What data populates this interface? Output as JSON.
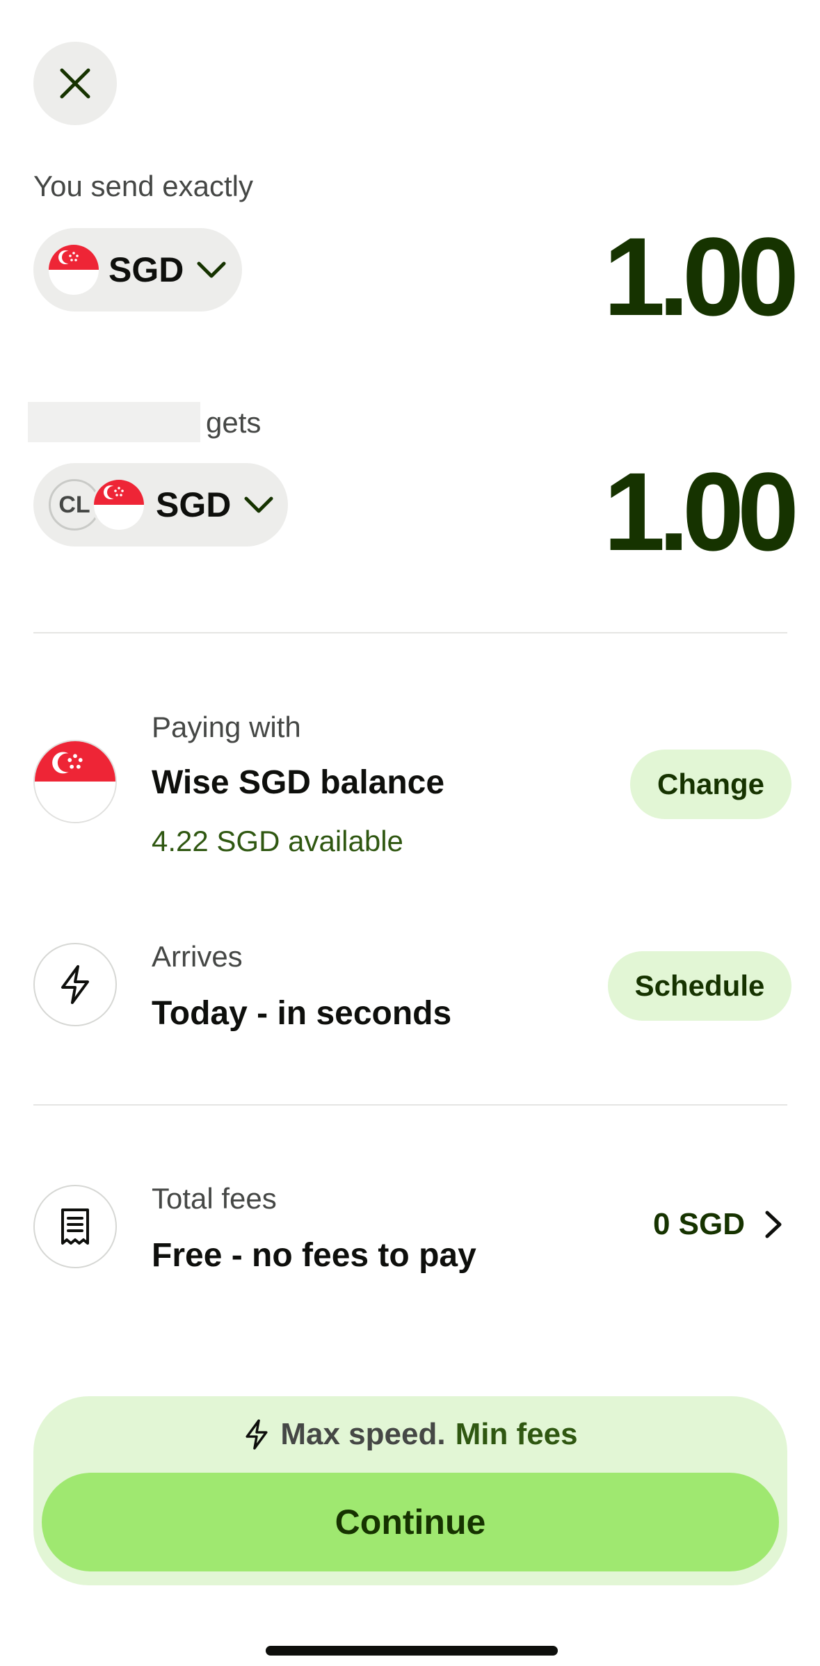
{
  "send": {
    "label": "You send exactly",
    "currency": "SGD",
    "amount": "1.00"
  },
  "recipient": {
    "gets_label": "gets",
    "badge": "CL",
    "currency": "SGD",
    "amount": "1.00"
  },
  "paying": {
    "label": "Paying with",
    "method": "Wise SGD balance",
    "available": "4.22 SGD available",
    "action": "Change"
  },
  "arrives": {
    "label": "Arrives",
    "value": "Today - in seconds",
    "action": "Schedule"
  },
  "fees": {
    "label": "Total fees",
    "value": "Free - no fees to pay",
    "amount": "0 SGD"
  },
  "promo": {
    "text_part1": "Max speed.",
    "text_part2": "Min fees"
  },
  "continue_label": "Continue",
  "icons": {
    "close": "close-icon",
    "flag": "singapore-flag-icon",
    "chevron": "chevron-down-icon",
    "bolt": "lightning-icon",
    "receipt": "receipt-icon",
    "arrow": "chevron-right-icon"
  },
  "colors": {
    "brand_dark": "#163300",
    "brand_green": "#9fe870",
    "light_green": "#e2f6d5",
    "accent_text": "#2f5711"
  }
}
